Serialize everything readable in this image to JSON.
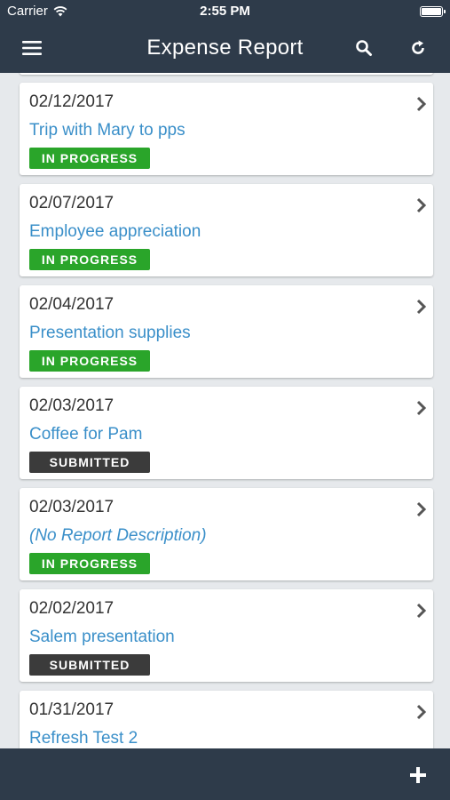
{
  "status_bar": {
    "carrier": "Carrier",
    "time": "2:55 PM"
  },
  "header": {
    "title": "Expense Report"
  },
  "reports": [
    {
      "date": "02/12/2017",
      "description": "Trip with Mary to pps",
      "status": "IN PROGRESS"
    },
    {
      "date": "02/07/2017",
      "description": "Employee appreciation",
      "status": "IN PROGRESS"
    },
    {
      "date": "02/04/2017",
      "description": "Presentation supplies",
      "status": "IN PROGRESS"
    },
    {
      "date": "02/03/2017",
      "description": "Coffee for Pam",
      "status": "SUBMITTED"
    },
    {
      "date": "02/03/2017",
      "description": "(No Report Description)",
      "status": "IN PROGRESS"
    },
    {
      "date": "02/02/2017",
      "description": "Salem presentation",
      "status": "SUBMITTED"
    },
    {
      "date": "01/31/2017",
      "description": "Refresh Test 2",
      "status": ""
    }
  ],
  "colors": {
    "header_bg": "#2e3b4a",
    "link": "#3a8fc9",
    "in_progress": "#2aa52a",
    "submitted": "#3b3b3b"
  },
  "icons": {
    "menu": "hamburger-icon",
    "search": "search-icon",
    "refresh": "refresh-icon",
    "add": "plus-icon",
    "row": "chevron-right-icon",
    "wifi": "wifi-icon",
    "battery": "battery-icon"
  }
}
